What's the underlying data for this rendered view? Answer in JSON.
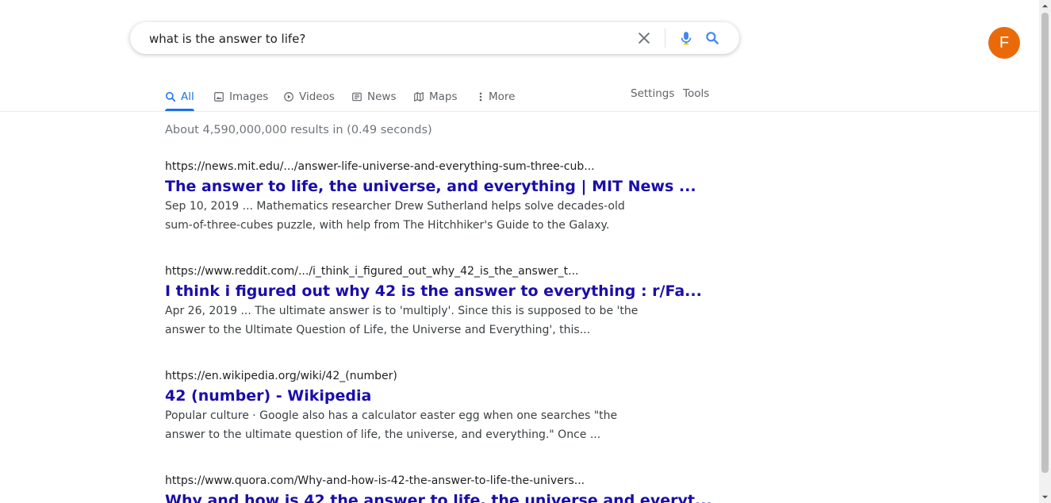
{
  "search": {
    "query": "what is the answer to life?"
  },
  "account": {
    "initial": "F",
    "avatar_color": "#ea6a0a"
  },
  "tabs": [
    {
      "label": "All",
      "icon": "search-icon",
      "active": true
    },
    {
      "label": "Images",
      "icon": "image-icon"
    },
    {
      "label": "Videos",
      "icon": "play-icon"
    },
    {
      "label": "News",
      "icon": "news-icon"
    },
    {
      "label": "Maps",
      "icon": "map-icon"
    },
    {
      "label": "More",
      "icon": "more-vert-icon"
    }
  ],
  "tools": {
    "settings": "Settings",
    "tools": "Tools"
  },
  "stats": "About 4,590,000,000 results in (0.49 seconds)",
  "results": [
    {
      "url": "https://news.mit.edu/.../answer-life-universe-and-everything-sum-three-cub...",
      "title": "The answer to life, the universe, and everything | MIT News ...",
      "snippet": "Sep 10, 2019 ... Mathematics researcher Drew Sutherland helps solve decades-old sum-of-three-cubes puzzle, with help from The Hitchhiker's Guide to the Galaxy."
    },
    {
      "url": "https://www.reddit.com/.../i_think_i_figured_out_why_42_is_the_answer_t...",
      "title": "I think i figured out why 42 is the answer to everything : r/Fa...",
      "snippet": "Apr 26, 2019 ... The ultimate answer is to 'multiply'. Since this is supposed to be 'the answer to the Ultimate Question of Life, the Universe and Everything', this..."
    },
    {
      "url": "https://en.wikipedia.org/wiki/42_(number)",
      "title": "42 (number) - Wikipedia",
      "snippet": "Popular culture · Google also has a calculator easter egg when one searches \"the answer to the ultimate question of life, the universe, and everything.\" Once ..."
    },
    {
      "url": "https://www.quora.com/Why-and-how-is-42-the-answer-to-life-the-univers...",
      "title": "Why and how is 42 the answer to life, the universe and everyt...",
      "snippet": ""
    }
  ],
  "colors": {
    "link": "#1a0dab",
    "accent": "#1a73e8",
    "muted": "#70757a"
  }
}
